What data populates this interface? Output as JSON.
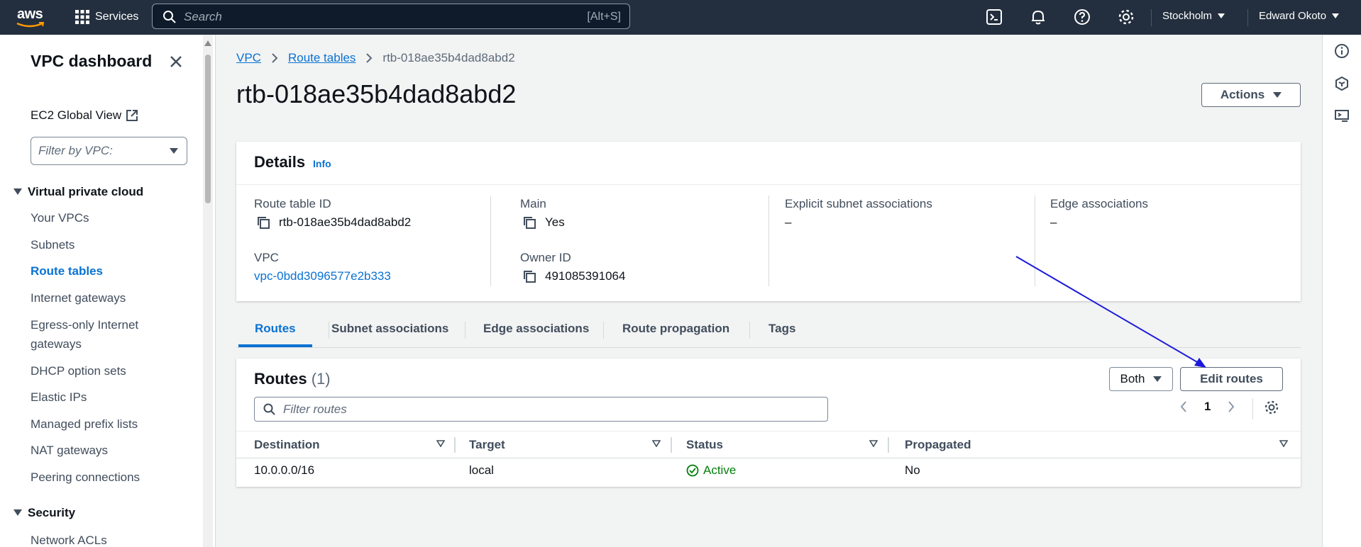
{
  "topnav": {
    "logo_text": "aws",
    "services_label": "Services",
    "search_placeholder": "Search",
    "search_shortcut": "[Alt+S]",
    "icons": [
      "cloudshell-icon",
      "bell-icon",
      "help-icon",
      "gear-icon"
    ],
    "region": "Stockholm",
    "user": "Edward Okoto"
  },
  "sidebar": {
    "title": "VPC dashboard",
    "ec2_global_view": "EC2 Global View",
    "filter_placeholder": "Filter by VPC:",
    "section_vpc": "Virtual private cloud",
    "items": [
      "Your VPCs",
      "Subnets",
      "Route tables",
      "Internet gateways",
      "Egress-only Internet gateways",
      "DHCP option sets",
      "Elastic IPs",
      "Managed prefix lists",
      "NAT gateways",
      "Peering connections"
    ],
    "active_item": "Route tables",
    "section_security": "Security",
    "security_items": [
      "Network ACLs"
    ]
  },
  "breadcrumb": {
    "vpc": "VPC",
    "route_tables": "Route tables",
    "current": "rtb-018ae35b4dad8abd2"
  },
  "page": {
    "title": "rtb-018ae35b4dad8abd2",
    "actions_label": "Actions"
  },
  "details": {
    "header": "Details",
    "info": "Info",
    "route_table_id_label": "Route table ID",
    "route_table_id": "rtb-018ae35b4dad8abd2",
    "main_label": "Main",
    "main": "Yes",
    "explicit_label": "Explicit subnet associations",
    "explicit": "–",
    "edge_label": "Edge associations",
    "edge": "–",
    "vpc_label": "VPC",
    "vpc": "vpc-0bdd3096577e2b333",
    "owner_label": "Owner ID",
    "owner": "491085391064"
  },
  "tabs": [
    "Routes",
    "Subnet associations",
    "Edge associations",
    "Route propagation",
    "Tags"
  ],
  "routes": {
    "header": "Routes",
    "count": "(1)",
    "both_label": "Both",
    "edit_label": "Edit routes",
    "filter_placeholder": "Filter routes",
    "page": "1",
    "columns": [
      "Destination",
      "Target",
      "Status",
      "Propagated"
    ],
    "rows": [
      {
        "destination": "10.0.0.0/16",
        "target": "local",
        "status": "Active",
        "propagated": "No"
      }
    ]
  },
  "colors": {
    "nav": "#232f3e",
    "link": "#0972d3",
    "success": "#037f0c",
    "annotation_arrow": "#1a1adb"
  }
}
